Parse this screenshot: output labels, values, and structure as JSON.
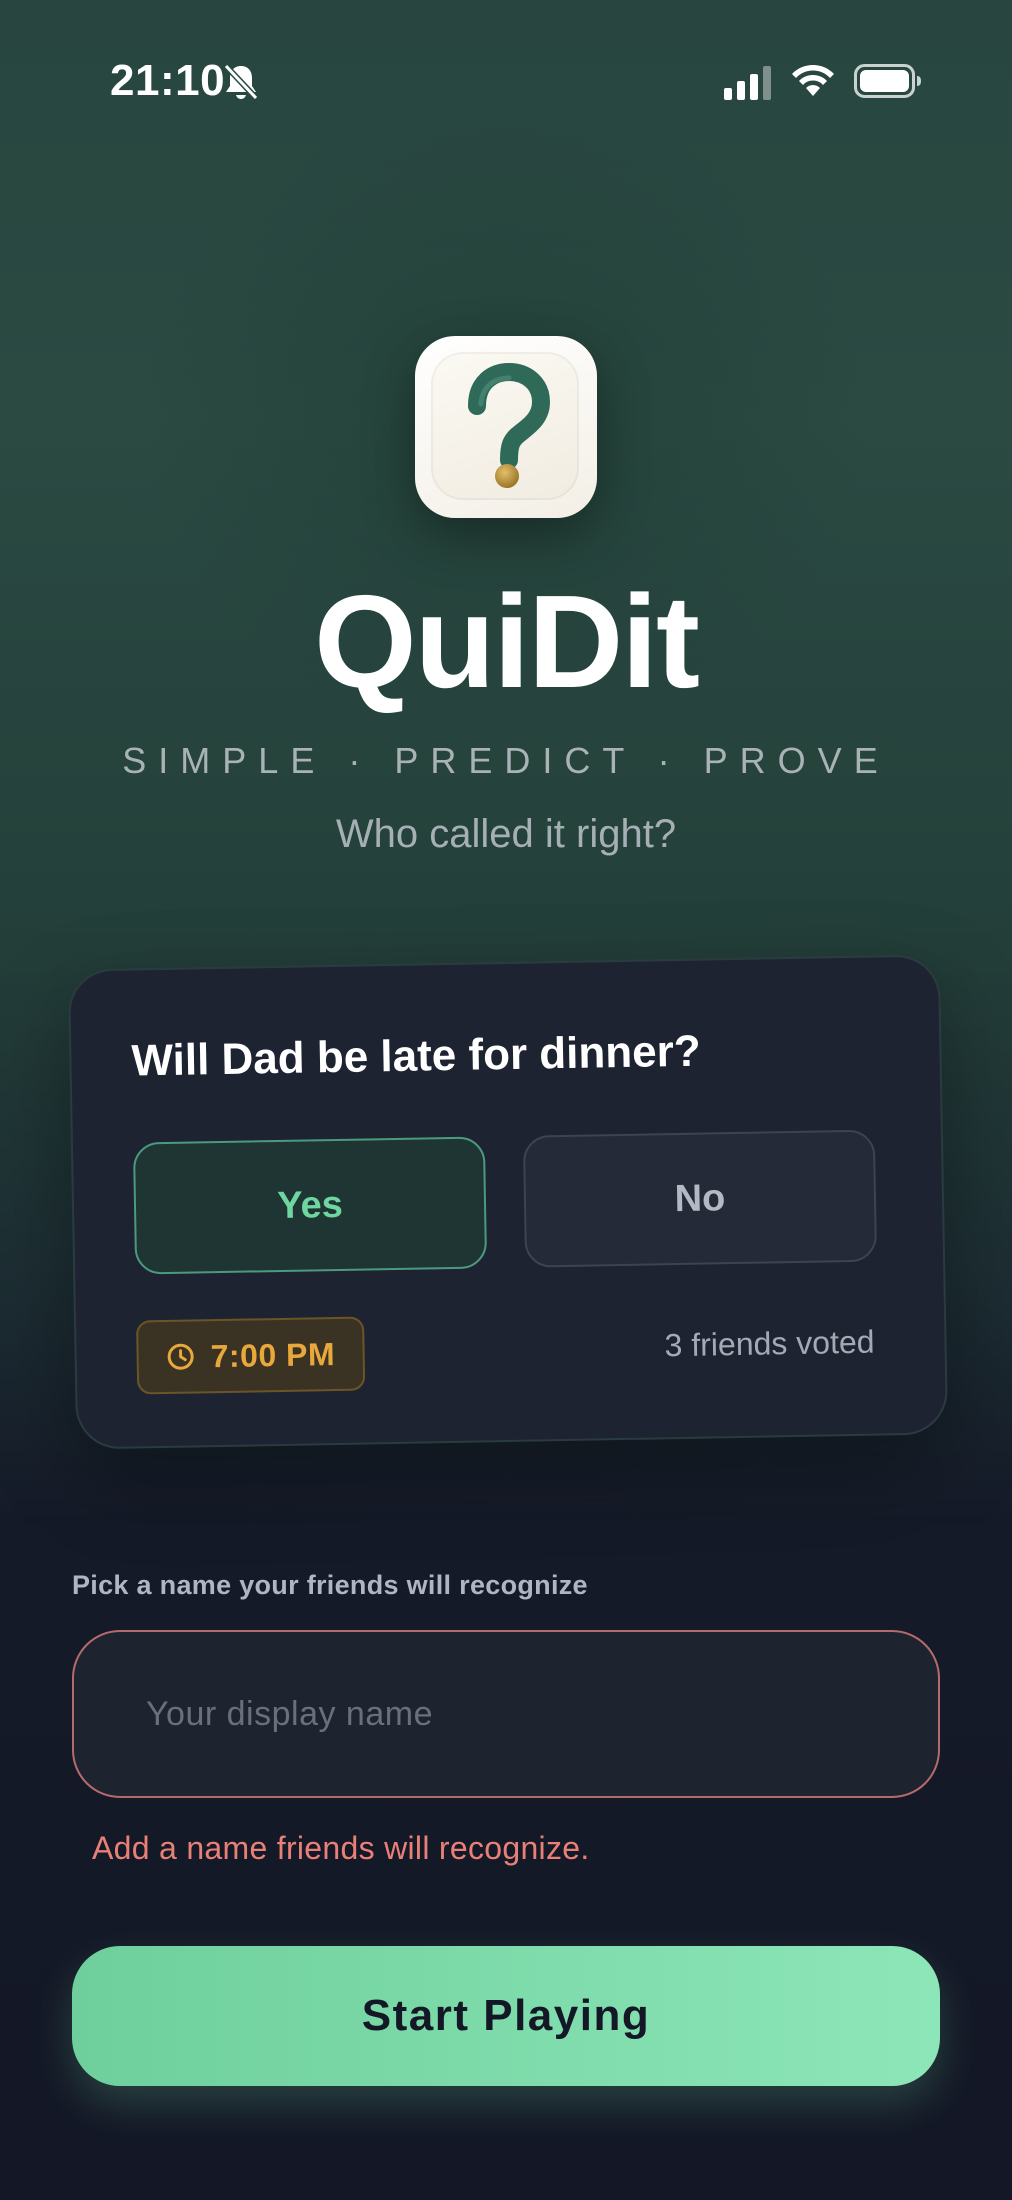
{
  "status_bar": {
    "time": "21:10",
    "icons": [
      "bell-slash-icon",
      "cellular-signal-icon",
      "wifi-icon",
      "battery-icon"
    ]
  },
  "app": {
    "icon": "question-mark-icon",
    "title": "QuiDit",
    "tagline": "SIMPLE · PREDICT · PROVE",
    "subtitle": "Who called it right?"
  },
  "card": {
    "question": "Will Dad be late for dinner?",
    "options": [
      {
        "label": "Yes",
        "selected": true
      },
      {
        "label": "No",
        "selected": false
      }
    ],
    "time_badge": {
      "icon": "clock-icon",
      "label": "7:00 PM"
    },
    "votes_text": "3 friends voted"
  },
  "form": {
    "label": "Pick a name your friends will recognize",
    "input_placeholder": "Your display name",
    "input_value": "",
    "error": "Add a name friends will recognize.",
    "submit_label": "Start Playing"
  },
  "colors": {
    "accent_green": "#6fd6a0",
    "badge_amber": "#e8a83c",
    "error_red": "#e98078",
    "card_bg": "#1e2331",
    "page_bg": "#141826"
  }
}
